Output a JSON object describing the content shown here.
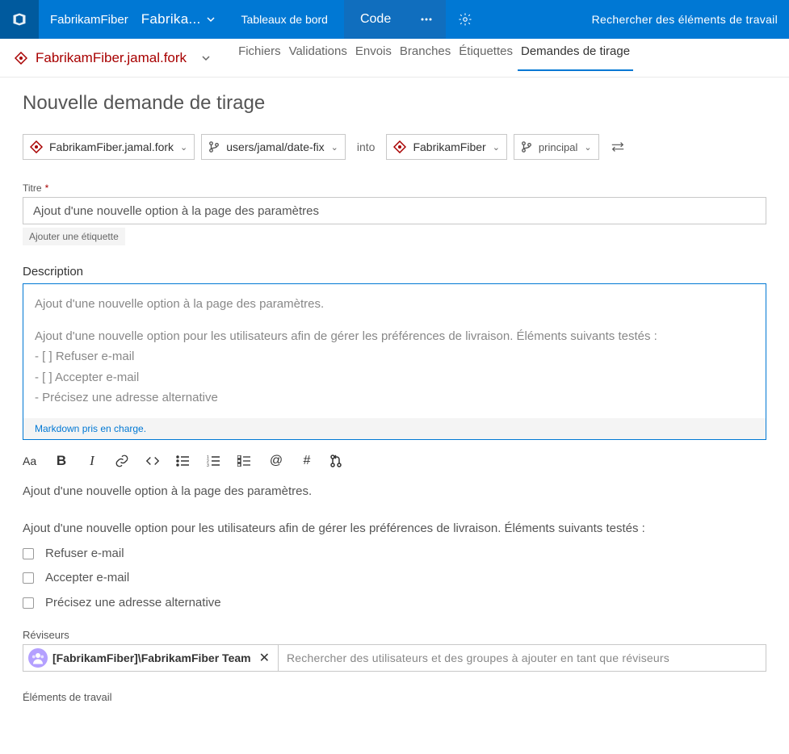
{
  "topnav": {
    "project": "FabrikamFiber",
    "project2": "Fabrika...",
    "tab_dashboards": "Tableaux de bord",
    "tab_code": "Code",
    "search_placeholder": "Rechercher des éléments de travail"
  },
  "subnav": {
    "repo": "FabrikamFiber.jamal.fork",
    "tabs": {
      "files": "Fichiers",
      "commits": "Validations",
      "pushes": "Envois",
      "branches": "Branches",
      "tags": "Étiquettes",
      "prs": "Demandes de tirage"
    }
  },
  "page": {
    "title": "Nouvelle demande de tirage",
    "source_repo": "FabrikamFiber.jamal.fork",
    "source_branch": "users/jamal/date-fix",
    "into": "into",
    "target_repo": "FabrikamFiber",
    "target_branch": "principal",
    "title_label": "Titre",
    "title_value": "Ajout d'une nouvelle option à la page des paramètres",
    "add_label": "Ajouter une étiquette",
    "desc_label": "Description",
    "desc_l1": "Ajout d'une nouvelle option à la page des paramètres.",
    "desc_l2": "Ajout d'une nouvelle option pour les utilisateurs afin de gérer les préférences de livraison. Éléments suivants testés :",
    "desc_l3": "- [ ] Refuser e-mail",
    "desc_l4": "- [ ] Accepter e-mail",
    "desc_l5": "- Précisez une adresse alternative",
    "md_note": "Markdown pris en charge.",
    "preview_l1": "Ajout d'une nouvelle option à la page des paramètres.",
    "preview_l2": "Ajout d'une nouvelle option pour les utilisateurs afin de gérer les préférences de livraison. Éléments suivants testés :",
    "preview_c1": "Refuser e-mail",
    "preview_c2": "Accepter e-mail",
    "preview_c3": "Précisez une adresse alternative",
    "reviewers_label": "Réviseurs",
    "reviewer_name": "[FabrikamFiber]\\FabrikamFiber Team",
    "reviewer_placeholder": "Rechercher des utilisateurs et des groupes à ajouter en tant que réviseurs",
    "workitems_label": "Éléments de travail"
  }
}
